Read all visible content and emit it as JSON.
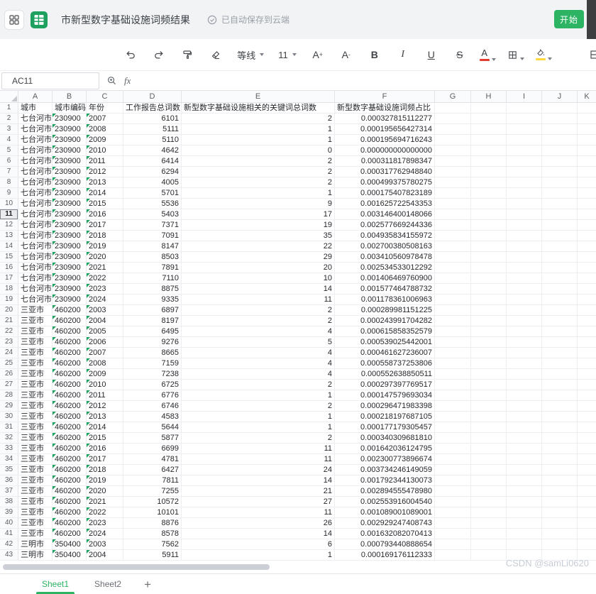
{
  "colors": {
    "accent_green": "#2cb464",
    "indicator_green": "#21a15f",
    "font_color_bar": "#e23d2e",
    "fill_color_bar": "#ffd83d",
    "watermark_gray": "#c7cdd6"
  },
  "titlebar": {
    "doc_title": "市新型数字基础设施词频结果",
    "autosave_status": "已自动保存到云端",
    "start_button_label": "开始"
  },
  "toolbar": {
    "font_name": "等线",
    "font_size": "11",
    "bold_label": "B",
    "italic_label": "I",
    "underline_label": "U",
    "strike_label": "S",
    "font_color_label": "A",
    "font_inc_label": "A",
    "font_inc_sup": "+",
    "font_dec_label": "A",
    "font_dec_sup": "-"
  },
  "formula_bar": {
    "name_box_value": "AC11",
    "fx_label": "fx",
    "formula_value": ""
  },
  "grid": {
    "column_letters": [
      "A",
      "B",
      "C",
      "D",
      "E",
      "F",
      "G",
      "H",
      "I",
      "J",
      "K"
    ],
    "visible_row_count": 43,
    "selected_row": 11,
    "header_cells": [
      "城市",
      "城市编码",
      "年份",
      "工作报告总词数",
      "新型数字基础设施相关的关键词总词数",
      "新型数字基础设施词频占比"
    ],
    "rows": [
      [
        "七台河市",
        "230900",
        "2007",
        "6101",
        "2",
        "0.000327815112277"
      ],
      [
        "七台河市",
        "230900",
        "2008",
        "5111",
        "1",
        "0.000195656427314"
      ],
      [
        "七台河市",
        "230900",
        "2009",
        "5110",
        "1",
        "0.000195694716243"
      ],
      [
        "七台河市",
        "230900",
        "2010",
        "4642",
        "0",
        "0.000000000000000"
      ],
      [
        "七台河市",
        "230900",
        "2011",
        "6414",
        "2",
        "0.000311817898347"
      ],
      [
        "七台河市",
        "230900",
        "2012",
        "6294",
        "2",
        "0.000317762948840"
      ],
      [
        "七台河市",
        "230900",
        "2013",
        "4005",
        "2",
        "0.000499375780275"
      ],
      [
        "七台河市",
        "230900",
        "2014",
        "5701",
        "1",
        "0.000175407823189"
      ],
      [
        "七台河市",
        "230900",
        "2015",
        "5536",
        "9",
        "0.001625722543353"
      ],
      [
        "七台河市",
        "230900",
        "2016",
        "5403",
        "17",
        "0.003146400148066"
      ],
      [
        "七台河市",
        "230900",
        "2017",
        "7371",
        "19",
        "0.002577669244336"
      ],
      [
        "七台河市",
        "230900",
        "2018",
        "7091",
        "35",
        "0.004935834155972"
      ],
      [
        "七台河市",
        "230900",
        "2019",
        "8147",
        "22",
        "0.002700380508163"
      ],
      [
        "七台河市",
        "230900",
        "2020",
        "8503",
        "29",
        "0.003410560978478"
      ],
      [
        "七台河市",
        "230900",
        "2021",
        "7891",
        "20",
        "0.002534533012292"
      ],
      [
        "七台河市",
        "230900",
        "2022",
        "7110",
        "10",
        "0.001406469760900"
      ],
      [
        "七台河市",
        "230900",
        "2023",
        "8875",
        "14",
        "0.001577464788732"
      ],
      [
        "七台河市",
        "230900",
        "2024",
        "9335",
        "11",
        "0.001178361006963"
      ],
      [
        "三亚市",
        "460200",
        "2003",
        "6897",
        "2",
        "0.000289981151225"
      ],
      [
        "三亚市",
        "460200",
        "2004",
        "8197",
        "2",
        "0.000243991704282"
      ],
      [
        "三亚市",
        "460200",
        "2005",
        "6495",
        "4",
        "0.000615858352579"
      ],
      [
        "三亚市",
        "460200",
        "2006",
        "9276",
        "5",
        "0.000539025442001"
      ],
      [
        "三亚市",
        "460200",
        "2007",
        "8665",
        "4",
        "0.000461627236007"
      ],
      [
        "三亚市",
        "460200",
        "2008",
        "7159",
        "4",
        "0.000558737253806"
      ],
      [
        "三亚市",
        "460200",
        "2009",
        "7238",
        "4",
        "0.000552638850511"
      ],
      [
        "三亚市",
        "460200",
        "2010",
        "6725",
        "2",
        "0.000297397769517"
      ],
      [
        "三亚市",
        "460200",
        "2011",
        "6776",
        "1",
        "0.000147579693034"
      ],
      [
        "三亚市",
        "460200",
        "2012",
        "6746",
        "2",
        "0.000296471983398"
      ],
      [
        "三亚市",
        "460200",
        "2013",
        "4583",
        "1",
        "0.000218197687105"
      ],
      [
        "三亚市",
        "460200",
        "2014",
        "5644",
        "1",
        "0.000177179305457"
      ],
      [
        "三亚市",
        "460200",
        "2015",
        "5877",
        "2",
        "0.000340309681810"
      ],
      [
        "三亚市",
        "460200",
        "2016",
        "6699",
        "11",
        "0.001642036124795"
      ],
      [
        "三亚市",
        "460200",
        "2017",
        "4781",
        "11",
        "0.002300773896674"
      ],
      [
        "三亚市",
        "460200",
        "2018",
        "6427",
        "24",
        "0.003734246149059"
      ],
      [
        "三亚市",
        "460200",
        "2019",
        "7811",
        "14",
        "0.001792344130073"
      ],
      [
        "三亚市",
        "460200",
        "2020",
        "7255",
        "21",
        "0.002894555478980"
      ],
      [
        "三亚市",
        "460200",
        "2021",
        "10572",
        "27",
        "0.002553916004540"
      ],
      [
        "三亚市",
        "460200",
        "2022",
        "10101",
        "11",
        "0.001089001089001"
      ],
      [
        "三亚市",
        "460200",
        "2023",
        "8876",
        "26",
        "0.002929247408743"
      ],
      [
        "三亚市",
        "460200",
        "2024",
        "8578",
        "14",
        "0.001632082070413"
      ],
      [
        "三明市",
        "350400",
        "2003",
        "7562",
        "6",
        "0.000793440888654"
      ],
      [
        "三明市",
        "350400",
        "2004",
        "5911",
        "1",
        "0.000169176112333"
      ]
    ]
  },
  "tabs": {
    "items": [
      {
        "label": "Sheet1",
        "active": true
      },
      {
        "label": "Sheet2",
        "active": false
      }
    ],
    "add_label": "+"
  },
  "watermark": "CSDN @samLi0620"
}
